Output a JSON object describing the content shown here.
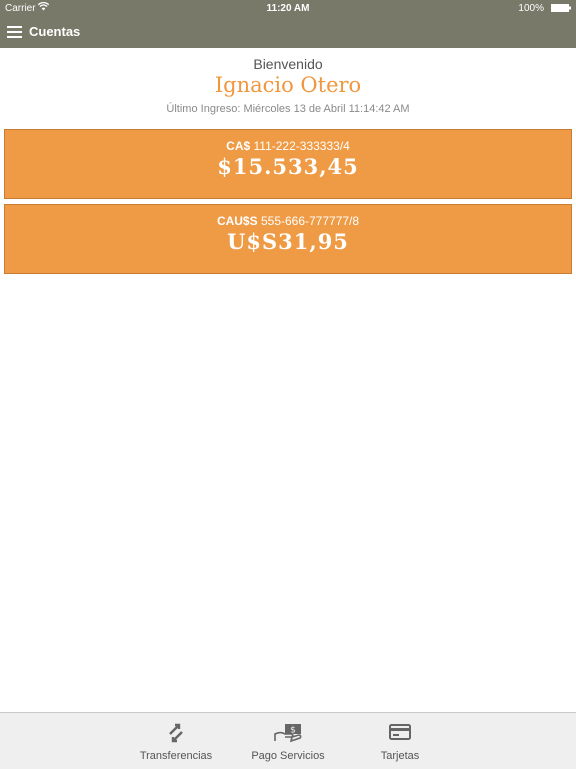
{
  "status": {
    "carrier": "Carrier",
    "time": "11:20 AM",
    "battery": "100%"
  },
  "nav": {
    "title": "Cuentas",
    "menu_icon": "hamburger-icon"
  },
  "welcome": {
    "label": "Bienvenido",
    "user_name": "Ignacio Otero",
    "last_login": "Último Ingreso: Miércoles 13 de Abril 11:14:42 AM"
  },
  "accounts": [
    {
      "type": "CA$",
      "number": "111-222-333333/4",
      "balance": "$15.533,45"
    },
    {
      "type": "CAU$S",
      "number": "555-666-777777/8",
      "balance": "U$S31,95"
    }
  ],
  "tabs": [
    {
      "label": "Transferencias",
      "icon": "transfer-arrows-icon"
    },
    {
      "label": "Pago Servicios",
      "icon": "payment-icon"
    },
    {
      "label": "Tarjetas",
      "icon": "credit-card-icon"
    }
  ],
  "colors": {
    "header": "#79796a",
    "accent": "#f0963e",
    "card": "#ef9a44",
    "tabbar": "#efefef"
  }
}
